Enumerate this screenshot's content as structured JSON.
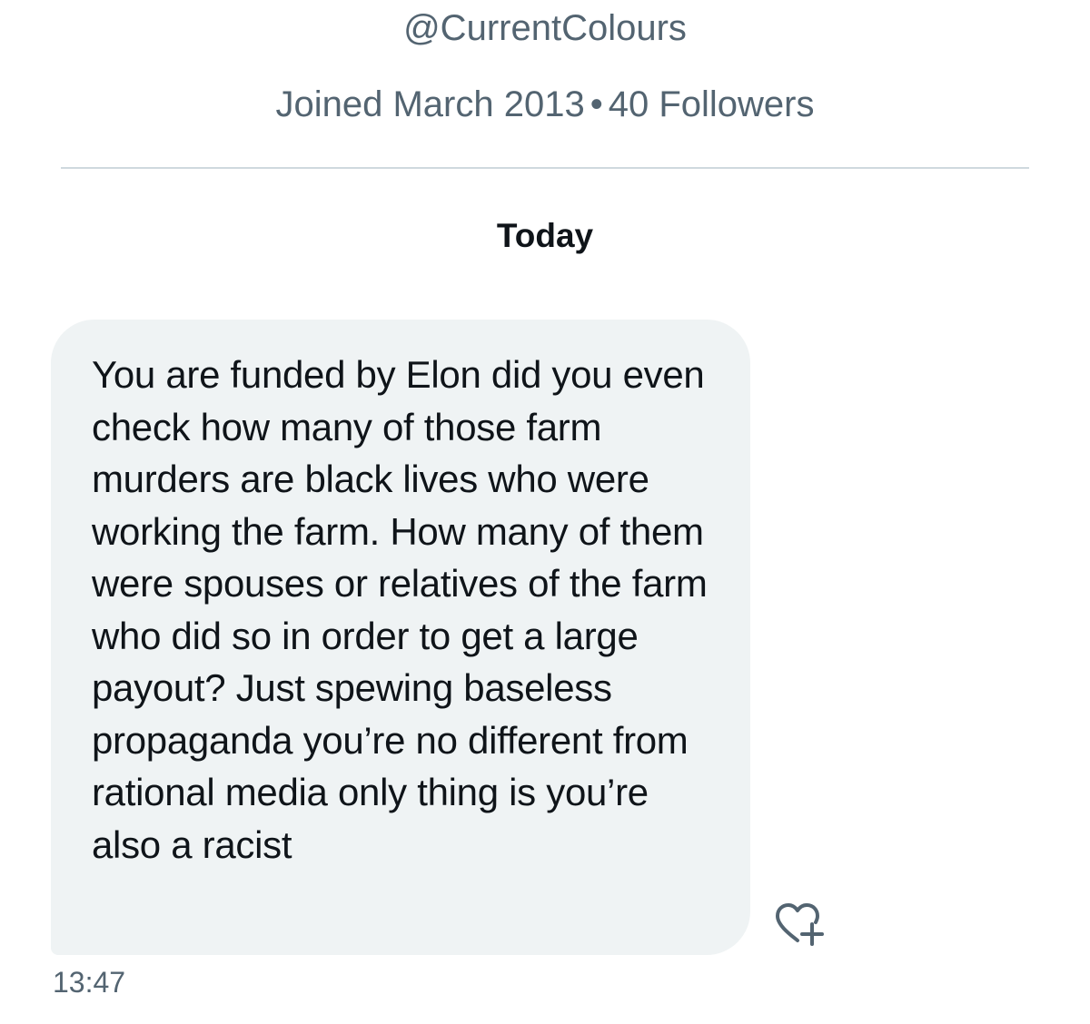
{
  "profile": {
    "handle": "@CurrentColours",
    "joined": "Joined March 2013",
    "separator": "•",
    "followers": "40 Followers"
  },
  "conversation": {
    "day_label": "Today",
    "messages": [
      {
        "text": "You are funded by Elon did you even check how many of those farm murders are black lives who were working the farm. How many of them were spouses or relatives of the farm who did so in order to get a large payout? Just spewing baseless propaganda you’re no different from rational media only thing is you’re also a racist",
        "time": "13:47",
        "reaction_icon": "heart-plus-icon"
      }
    ]
  },
  "colors": {
    "bubble_background": "#eff3f4",
    "secondary_text": "#536471",
    "primary_text": "#0f1419",
    "divider": "#cfd9de"
  }
}
